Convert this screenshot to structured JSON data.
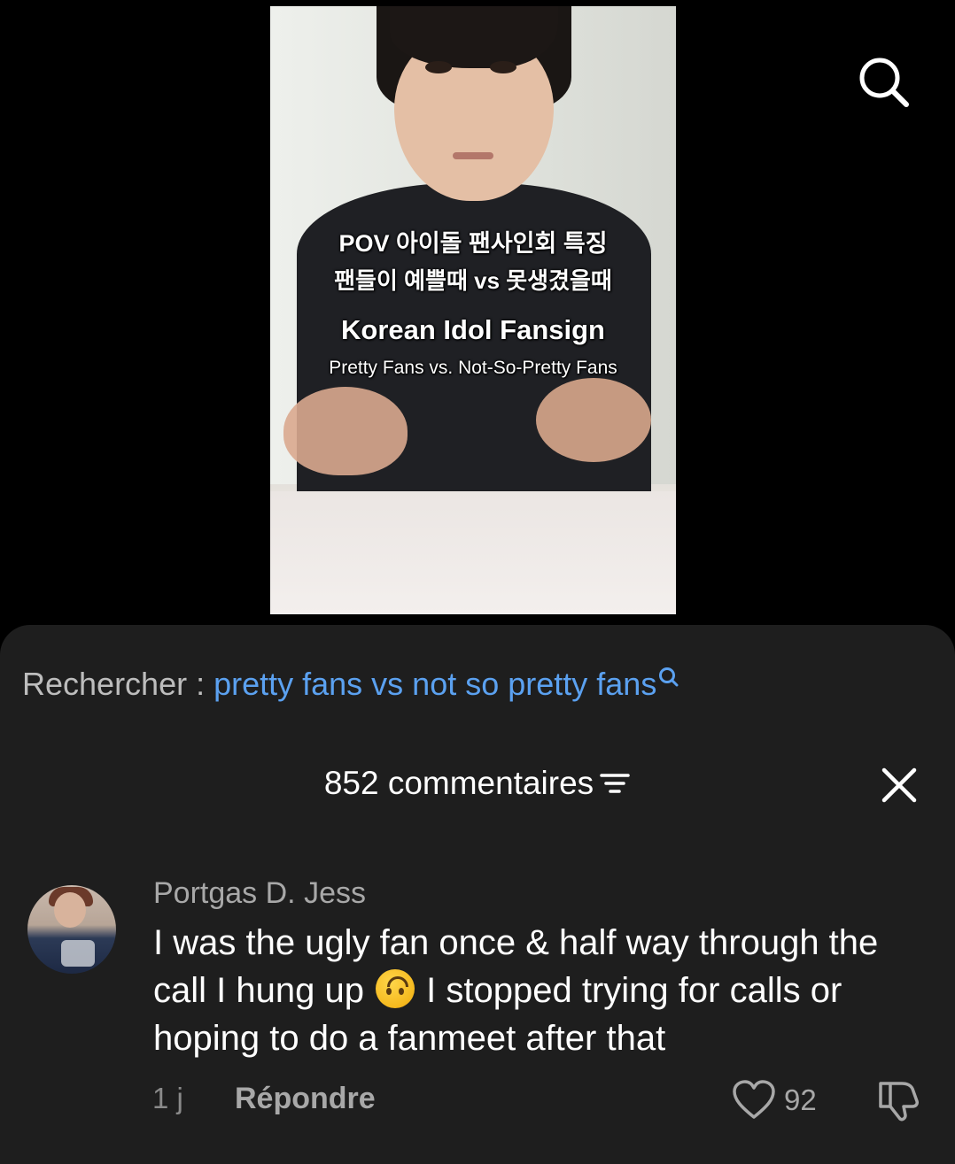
{
  "video": {
    "caption_line1": "POV 아이돌 팬사인회 특징",
    "caption_line2": "팬들이 예쁠때 vs 못생겼을때",
    "caption_line3": "Korean Idol Fansign",
    "caption_line4": "Pretty Fans vs. Not-So-Pretty Fans"
  },
  "top_search_icon": "search-icon",
  "search_bar": {
    "prefix": "Rechercher : ",
    "query": "pretty fans vs not so pretty fans"
  },
  "comments_header": {
    "title": "852 commentaires",
    "filter_icon": "filter-icon",
    "close_icon": "close-icon"
  },
  "comment": {
    "username": "Portgas D. Jess",
    "text_part1": "I was the ugly fan once & half way through the call I hung up ",
    "emoji": "upside-down-face",
    "text_part2": " I stopped trying for calls or hoping to do a fanmeet after that",
    "time": "1 j",
    "reply_label": "Répondre",
    "like_count": "92"
  },
  "colors": {
    "sheet_bg": "#1e1e1e",
    "link_blue": "#5ba1f0",
    "muted_text": "#a8a8a8"
  }
}
